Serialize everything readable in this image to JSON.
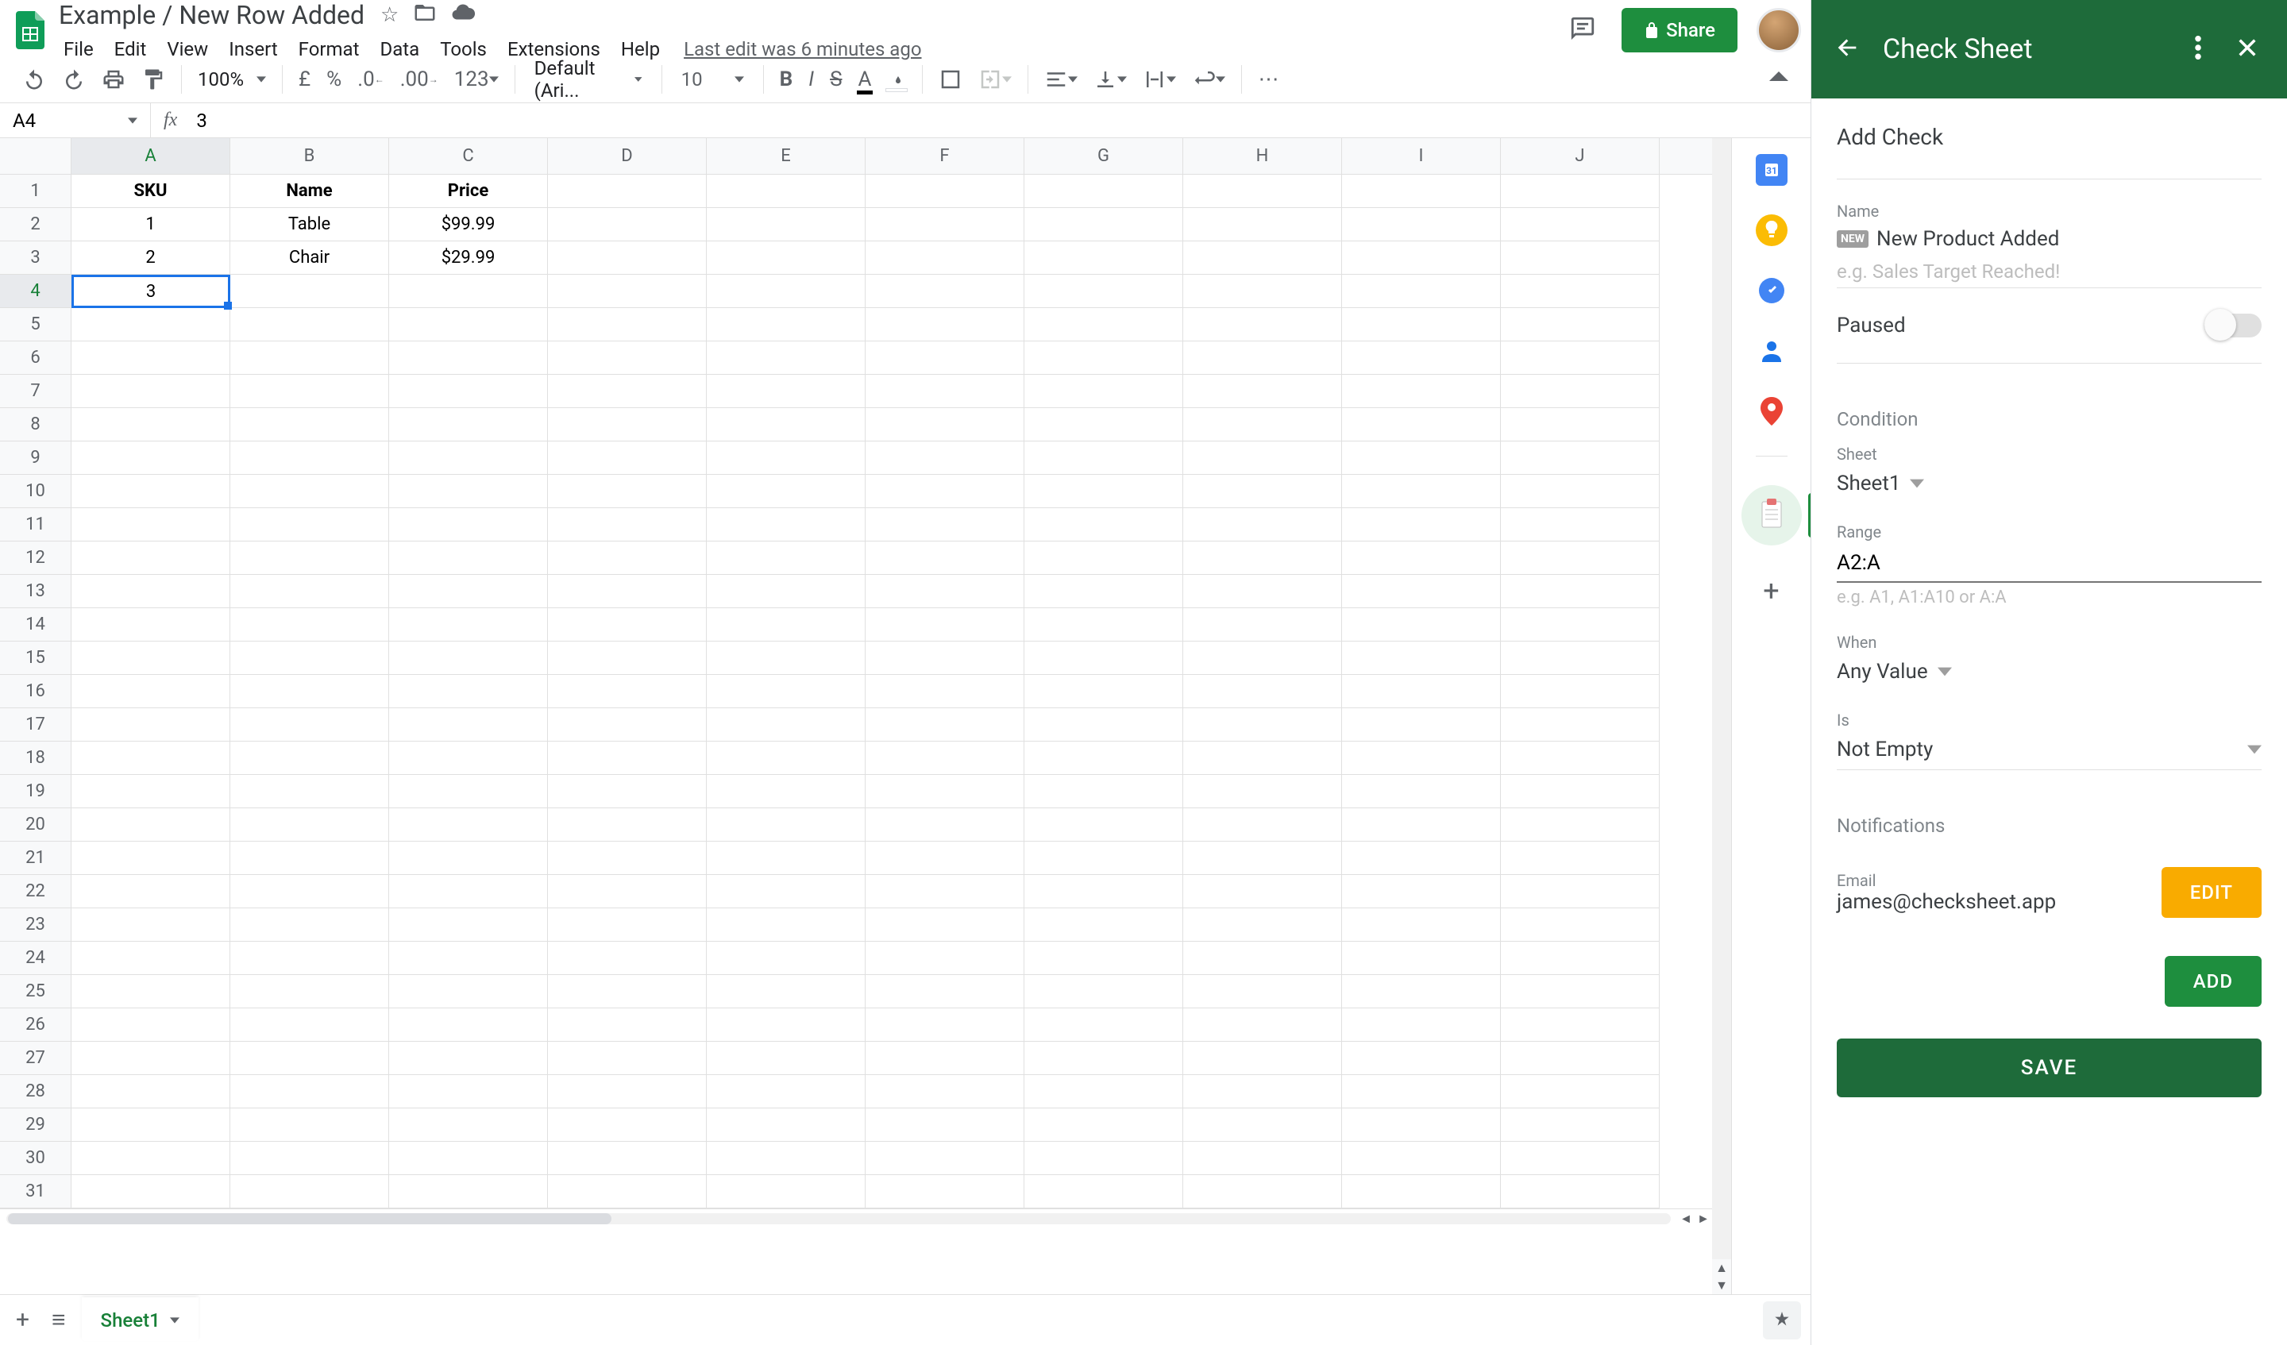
{
  "doc": {
    "title": "Example / New Row Added",
    "last_edit": "Last edit was 6 minutes ago"
  },
  "menus": [
    "File",
    "Edit",
    "View",
    "Insert",
    "Format",
    "Data",
    "Tools",
    "Extensions",
    "Help"
  ],
  "share_label": "Share",
  "toolbar": {
    "zoom": "100%",
    "font": "Default (Ari...",
    "font_size": "10",
    "number_fmt": "123"
  },
  "formula_bar": {
    "cell_ref": "A4",
    "formula": "3"
  },
  "columns": [
    "A",
    "B",
    "C",
    "D",
    "E",
    "F",
    "G",
    "H",
    "I",
    "J"
  ],
  "row_count": 31,
  "sheet_data": {
    "headers": [
      "SKU",
      "Name",
      "Price"
    ],
    "rows": [
      [
        "1",
        "Table",
        "$99.99"
      ],
      [
        "2",
        "Chair",
        "$29.99"
      ],
      [
        "3",
        "",
        ""
      ]
    ],
    "selected_cell": {
      "row": 4,
      "col": "A"
    }
  },
  "sheet_tab": "Sheet1",
  "sidepanel": {
    "title": "Check Sheet",
    "subtitle": "Add Check",
    "name_label": "Name",
    "name_badge": "NEW",
    "name_value": "New Product Added",
    "name_placeholder": "e.g. Sales Target Reached!",
    "paused_label": "Paused",
    "condition_label": "Condition",
    "sheet_label": "Sheet",
    "sheet_value": "Sheet1",
    "range_label": "Range",
    "range_value": "A2:A",
    "range_hint": "e.g. A1, A1:A10 or A:A",
    "when_label": "When",
    "when_value": "Any Value",
    "is_label": "Is",
    "is_value": "Not Empty",
    "notifications_label": "Notifications",
    "email_label": "Email",
    "email_value": "james@checksheet.app",
    "edit_btn": "EDIT",
    "add_btn": "ADD",
    "save_btn": "SAVE"
  }
}
